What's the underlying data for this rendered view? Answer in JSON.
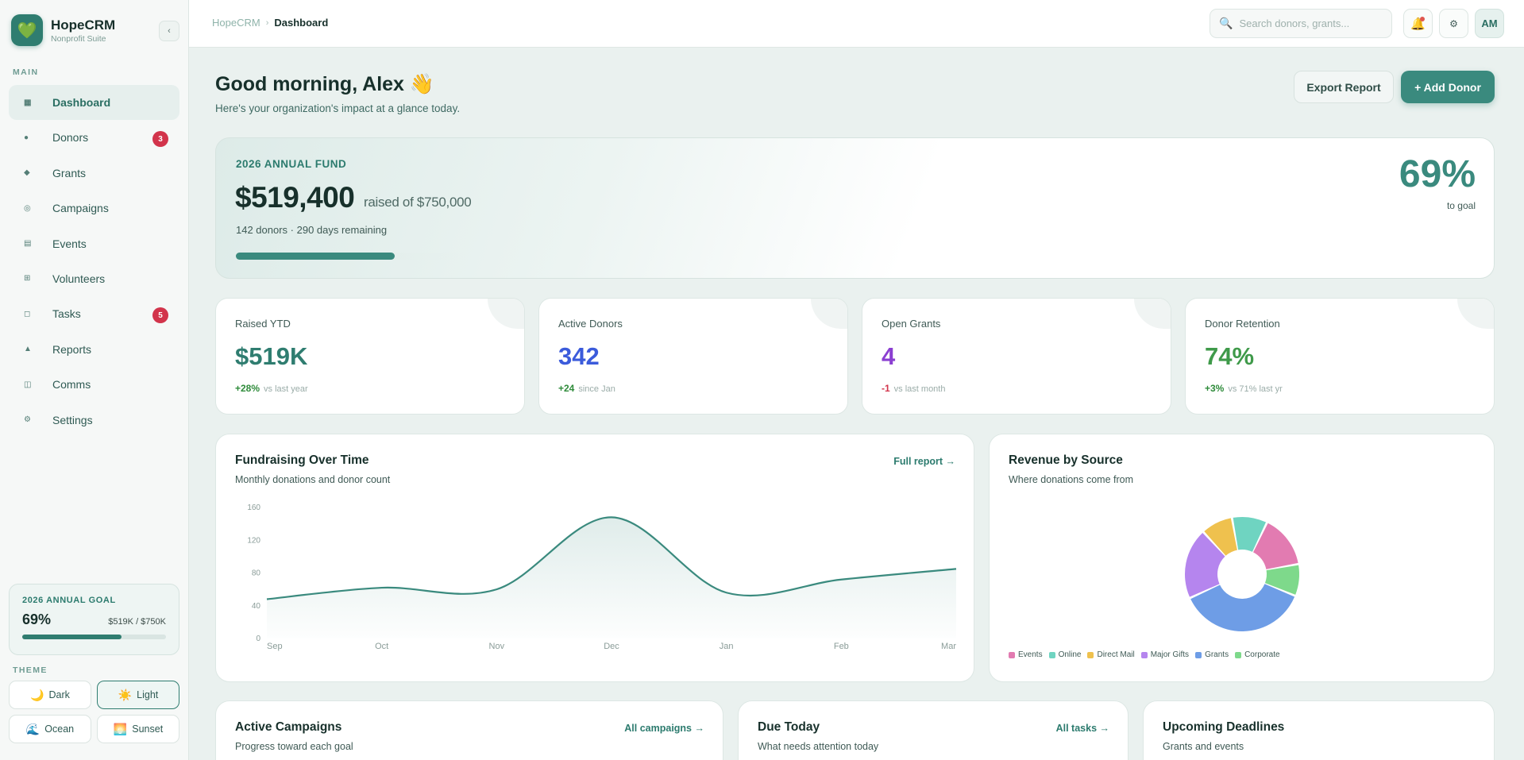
{
  "app": {
    "name": "HopeCRM",
    "subtitle": "Nonprofit Suite",
    "logo_icon": "heart-icon",
    "collapse_label": "‹"
  },
  "sidebar": {
    "section_main": "MAIN",
    "items": [
      {
        "label": "Dashboard",
        "icon": "▦",
        "icon_name": "grid-icon",
        "active": true
      },
      {
        "label": "Donors",
        "icon": "●",
        "icon_name": "donors-icon",
        "badge": "3"
      },
      {
        "label": "Grants",
        "icon": "◆",
        "icon_name": "grants-icon"
      },
      {
        "label": "Campaigns",
        "icon": "◎",
        "icon_name": "campaigns-icon"
      },
      {
        "label": "Events",
        "icon": "▤",
        "icon_name": "events-icon"
      },
      {
        "label": "Volunteers",
        "icon": "⊞",
        "icon_name": "volunteers-icon"
      },
      {
        "label": "Tasks",
        "icon": "◻",
        "icon_name": "tasks-icon",
        "badge": "5"
      },
      {
        "label": "Reports",
        "icon": "▲",
        "icon_name": "reports-icon"
      },
      {
        "label": "Comms",
        "icon": "◫",
        "icon_name": "comms-icon"
      },
      {
        "label": "Settings",
        "icon": "⚙",
        "icon_name": "settings-icon"
      }
    ],
    "goal": {
      "title": "2026 ANNUAL GOAL",
      "pct": "69%",
      "amount": "$519K / $750K",
      "progress": 0.69
    },
    "theme_label": "THEME",
    "themes": [
      {
        "label": "Dark",
        "icon": "🌙",
        "active": false
      },
      {
        "label": "Light",
        "icon": "☀️",
        "active": true
      },
      {
        "label": "Ocean",
        "icon": "🌊",
        "active": false
      },
      {
        "label": "Sunset",
        "icon": "🌅",
        "active": false
      }
    ]
  },
  "topbar": {
    "breadcrumb_root": "HopeCRM",
    "breadcrumb_sep": "›",
    "breadcrumb_current": "Dashboard",
    "search_placeholder": "Search donors, grants...",
    "avatar": "AM"
  },
  "header": {
    "greeting": "Good morning, Alex 👋",
    "subtitle": "Here's your organization's impact at a glance today.",
    "export_label": "Export Report",
    "add_label": "+ Add Donor"
  },
  "hero": {
    "label": "2026 ANNUAL FUND",
    "amount": "$519,400",
    "of_text": "raised of $750,000",
    "meta": "142 donors · 290 days remaining",
    "pct": "69%",
    "pct_sub": "to goal",
    "progress": 0.69
  },
  "kpis": [
    {
      "label": "Raised YTD",
      "value": "$519K",
      "delta": "+28%",
      "note": "vs last year",
      "color": "#2f7d70",
      "delta_color": "#2e8b3a"
    },
    {
      "label": "Active Donors",
      "value": "342",
      "delta": "+24",
      "note": "since Jan",
      "color": "#3b5bdb",
      "delta_color": "#2e8b3a"
    },
    {
      "label": "Open Grants",
      "value": "4",
      "delta": "-1",
      "note": "vs last month",
      "color": "#8b3fd1",
      "delta_color": "#d2344b"
    },
    {
      "label": "Donor Retention",
      "value": "74%",
      "delta": "+3%",
      "note": "vs 71% last yr",
      "color": "#3f9a4a",
      "delta_color": "#2e8b3a"
    }
  ],
  "fundraising": {
    "title": "Fundraising Over Time",
    "subtitle": "Monthly donations and donor count",
    "link": "Full report →"
  },
  "revenue": {
    "title": "Revenue by Source",
    "subtitle": "Where donations come from"
  },
  "campaigns": {
    "title": "Active Campaigns",
    "subtitle": "Progress toward each goal",
    "link": "All campaigns →"
  },
  "due_today": {
    "title": "Due Today",
    "subtitle": "What needs attention today",
    "link": "All tasks →"
  },
  "deadlines": {
    "title": "Upcoming Deadlines",
    "subtitle": "Grants and events"
  },
  "chart_data": [
    {
      "type": "area",
      "x": [
        "Sep",
        "Oct",
        "Nov",
        "Dec",
        "Jan",
        "Feb",
        "Mar"
      ],
      "y_ticks": [
        "0",
        "40",
        "80",
        "120",
        "160"
      ],
      "ylim": [
        0,
        160
      ],
      "series": [
        {
          "values": [
            48,
            62,
            60,
            148,
            56,
            72,
            85
          ]
        }
      ],
      "color": "#3a8a7e",
      "title": "",
      "xlabel": "",
      "ylabel": ""
    },
    {
      "type": "pie",
      "donut": true,
      "categories": [
        "Events",
        "Online",
        "Direct Mail",
        "Major Gifts",
        "Grants",
        "Corporate"
      ],
      "values": [
        15,
        10,
        9,
        20,
        37,
        9
      ],
      "order": [
        "Events",
        "Corporate",
        "Grants",
        "Major Gifts",
        "Direct Mail",
        "Online"
      ],
      "colors": [
        "#e27bb1",
        "#6fd4c1",
        "#efc14e",
        "#b585ee",
        "#6e9de6",
        "#7ed98b"
      ]
    }
  ]
}
